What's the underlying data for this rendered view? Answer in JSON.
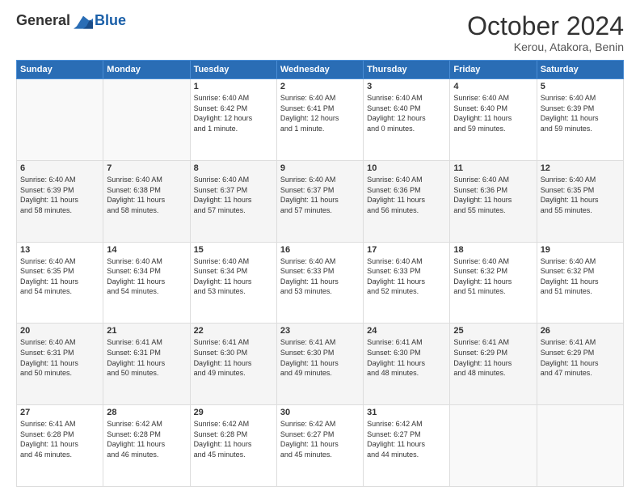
{
  "logo": {
    "general": "General",
    "blue": "Blue"
  },
  "header": {
    "month_title": "October 2024",
    "subtitle": "Kerou, Atakora, Benin"
  },
  "weekdays": [
    "Sunday",
    "Monday",
    "Tuesday",
    "Wednesday",
    "Thursday",
    "Friday",
    "Saturday"
  ],
  "weeks": [
    [
      {
        "day": "",
        "info": ""
      },
      {
        "day": "",
        "info": ""
      },
      {
        "day": "1",
        "info": "Sunrise: 6:40 AM\nSunset: 6:42 PM\nDaylight: 12 hours\nand 1 minute."
      },
      {
        "day": "2",
        "info": "Sunrise: 6:40 AM\nSunset: 6:41 PM\nDaylight: 12 hours\nand 1 minute."
      },
      {
        "day": "3",
        "info": "Sunrise: 6:40 AM\nSunset: 6:40 PM\nDaylight: 12 hours\nand 0 minutes."
      },
      {
        "day": "4",
        "info": "Sunrise: 6:40 AM\nSunset: 6:40 PM\nDaylight: 11 hours\nand 59 minutes."
      },
      {
        "day": "5",
        "info": "Sunrise: 6:40 AM\nSunset: 6:39 PM\nDaylight: 11 hours\nand 59 minutes."
      }
    ],
    [
      {
        "day": "6",
        "info": "Sunrise: 6:40 AM\nSunset: 6:39 PM\nDaylight: 11 hours\nand 58 minutes."
      },
      {
        "day": "7",
        "info": "Sunrise: 6:40 AM\nSunset: 6:38 PM\nDaylight: 11 hours\nand 58 minutes."
      },
      {
        "day": "8",
        "info": "Sunrise: 6:40 AM\nSunset: 6:37 PM\nDaylight: 11 hours\nand 57 minutes."
      },
      {
        "day": "9",
        "info": "Sunrise: 6:40 AM\nSunset: 6:37 PM\nDaylight: 11 hours\nand 57 minutes."
      },
      {
        "day": "10",
        "info": "Sunrise: 6:40 AM\nSunset: 6:36 PM\nDaylight: 11 hours\nand 56 minutes."
      },
      {
        "day": "11",
        "info": "Sunrise: 6:40 AM\nSunset: 6:36 PM\nDaylight: 11 hours\nand 55 minutes."
      },
      {
        "day": "12",
        "info": "Sunrise: 6:40 AM\nSunset: 6:35 PM\nDaylight: 11 hours\nand 55 minutes."
      }
    ],
    [
      {
        "day": "13",
        "info": "Sunrise: 6:40 AM\nSunset: 6:35 PM\nDaylight: 11 hours\nand 54 minutes."
      },
      {
        "day": "14",
        "info": "Sunrise: 6:40 AM\nSunset: 6:34 PM\nDaylight: 11 hours\nand 54 minutes."
      },
      {
        "day": "15",
        "info": "Sunrise: 6:40 AM\nSunset: 6:34 PM\nDaylight: 11 hours\nand 53 minutes."
      },
      {
        "day": "16",
        "info": "Sunrise: 6:40 AM\nSunset: 6:33 PM\nDaylight: 11 hours\nand 53 minutes."
      },
      {
        "day": "17",
        "info": "Sunrise: 6:40 AM\nSunset: 6:33 PM\nDaylight: 11 hours\nand 52 minutes."
      },
      {
        "day": "18",
        "info": "Sunrise: 6:40 AM\nSunset: 6:32 PM\nDaylight: 11 hours\nand 51 minutes."
      },
      {
        "day": "19",
        "info": "Sunrise: 6:40 AM\nSunset: 6:32 PM\nDaylight: 11 hours\nand 51 minutes."
      }
    ],
    [
      {
        "day": "20",
        "info": "Sunrise: 6:40 AM\nSunset: 6:31 PM\nDaylight: 11 hours\nand 50 minutes."
      },
      {
        "day": "21",
        "info": "Sunrise: 6:41 AM\nSunset: 6:31 PM\nDaylight: 11 hours\nand 50 minutes."
      },
      {
        "day": "22",
        "info": "Sunrise: 6:41 AM\nSunset: 6:30 PM\nDaylight: 11 hours\nand 49 minutes."
      },
      {
        "day": "23",
        "info": "Sunrise: 6:41 AM\nSunset: 6:30 PM\nDaylight: 11 hours\nand 49 minutes."
      },
      {
        "day": "24",
        "info": "Sunrise: 6:41 AM\nSunset: 6:30 PM\nDaylight: 11 hours\nand 48 minutes."
      },
      {
        "day": "25",
        "info": "Sunrise: 6:41 AM\nSunset: 6:29 PM\nDaylight: 11 hours\nand 48 minutes."
      },
      {
        "day": "26",
        "info": "Sunrise: 6:41 AM\nSunset: 6:29 PM\nDaylight: 11 hours\nand 47 minutes."
      }
    ],
    [
      {
        "day": "27",
        "info": "Sunrise: 6:41 AM\nSunset: 6:28 PM\nDaylight: 11 hours\nand 46 minutes."
      },
      {
        "day": "28",
        "info": "Sunrise: 6:42 AM\nSunset: 6:28 PM\nDaylight: 11 hours\nand 46 minutes."
      },
      {
        "day": "29",
        "info": "Sunrise: 6:42 AM\nSunset: 6:28 PM\nDaylight: 11 hours\nand 45 minutes."
      },
      {
        "day": "30",
        "info": "Sunrise: 6:42 AM\nSunset: 6:27 PM\nDaylight: 11 hours\nand 45 minutes."
      },
      {
        "day": "31",
        "info": "Sunrise: 6:42 AM\nSunset: 6:27 PM\nDaylight: 11 hours\nand 44 minutes."
      },
      {
        "day": "",
        "info": ""
      },
      {
        "day": "",
        "info": ""
      }
    ]
  ]
}
